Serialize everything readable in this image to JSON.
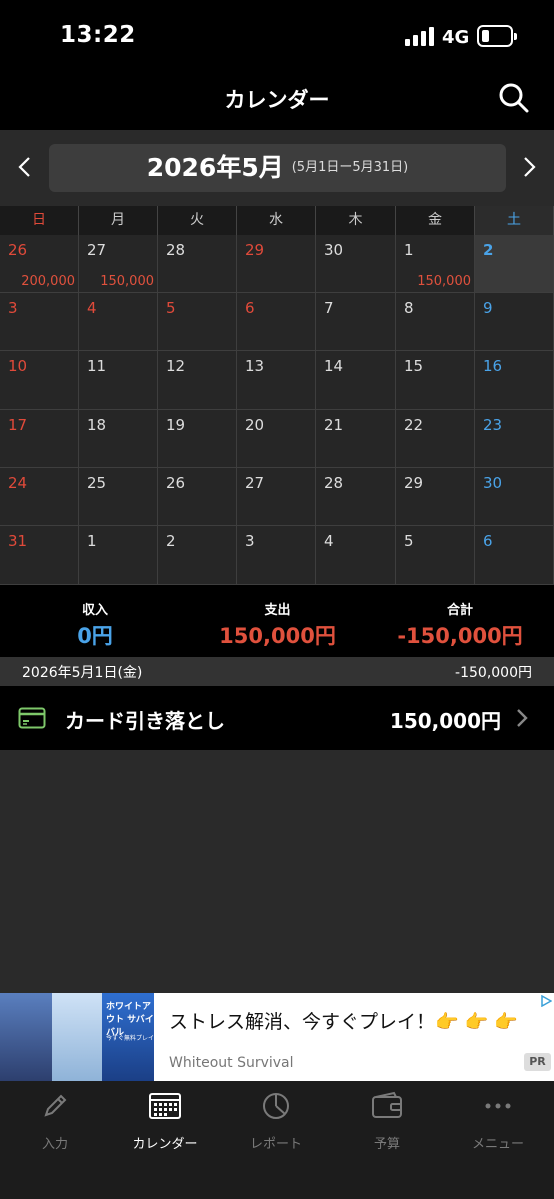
{
  "status_bar": {
    "time": "13:22",
    "network": "4G"
  },
  "header": {
    "title": "カレンダー"
  },
  "month_nav": {
    "month": "2026年5月",
    "range": "(5月1日ー5月31日)"
  },
  "weekdays": [
    "日",
    "月",
    "火",
    "水",
    "木",
    "金",
    "土"
  ],
  "calendar": {
    "weeks": [
      [
        {
          "day": "26",
          "amount": "200,000"
        },
        {
          "day": "27",
          "amount": "150,000"
        },
        {
          "day": "28",
          "amount": ""
        },
        {
          "day": "29",
          "amount": ""
        },
        {
          "day": "30",
          "amount": ""
        },
        {
          "day": "1",
          "amount": "150,000"
        },
        {
          "day": "2",
          "amount": ""
        }
      ],
      [
        {
          "day": "3",
          "amount": ""
        },
        {
          "day": "4",
          "amount": ""
        },
        {
          "day": "5",
          "amount": ""
        },
        {
          "day": "6",
          "amount": ""
        },
        {
          "day": "7",
          "amount": ""
        },
        {
          "day": "8",
          "amount": ""
        },
        {
          "day": "9",
          "amount": ""
        }
      ],
      [
        {
          "day": "10",
          "amount": ""
        },
        {
          "day": "11",
          "amount": ""
        },
        {
          "day": "12",
          "amount": ""
        },
        {
          "day": "13",
          "amount": ""
        },
        {
          "day": "14",
          "amount": ""
        },
        {
          "day": "15",
          "amount": ""
        },
        {
          "day": "16",
          "amount": ""
        }
      ],
      [
        {
          "day": "17",
          "amount": ""
        },
        {
          "day": "18",
          "amount": ""
        },
        {
          "day": "19",
          "amount": ""
        },
        {
          "day": "20",
          "amount": ""
        },
        {
          "day": "21",
          "amount": ""
        },
        {
          "day": "22",
          "amount": ""
        },
        {
          "day": "23",
          "amount": ""
        }
      ],
      [
        {
          "day": "24",
          "amount": ""
        },
        {
          "day": "25",
          "amount": ""
        },
        {
          "day": "26",
          "amount": ""
        },
        {
          "day": "27",
          "amount": ""
        },
        {
          "day": "28",
          "amount": ""
        },
        {
          "day": "29",
          "amount": ""
        },
        {
          "day": "30",
          "amount": ""
        }
      ],
      [
        {
          "day": "31",
          "amount": ""
        },
        {
          "day": "1",
          "amount": ""
        },
        {
          "day": "2",
          "amount": ""
        },
        {
          "day": "3",
          "amount": ""
        },
        {
          "day": "4",
          "amount": ""
        },
        {
          "day": "5",
          "amount": ""
        },
        {
          "day": "6",
          "amount": ""
        }
      ]
    ],
    "selected_day": "2"
  },
  "summary": {
    "income_label": "収入",
    "income_value": "0円",
    "expense_label": "支出",
    "expense_value": "150,000円",
    "total_label": "合計",
    "total_value": "-150,000円"
  },
  "date_bar": {
    "date": "2026年5月1日(金)",
    "total": "-150,000円"
  },
  "transaction": {
    "name": "カード引き落とし",
    "amount": "150,000円",
    "icon": "credit-card-icon"
  },
  "ad": {
    "headline": "ストレス解消、今すぐプレイ！👉 👉 👉",
    "brand": "Whiteout Survival",
    "pr_label": "PR",
    "thumb_logo": "ホワイトアウト サバイバル",
    "thumb_sub": "今すぐ無料プレイ"
  },
  "tabs": [
    {
      "label": "入力",
      "icon": "pencil-icon"
    },
    {
      "label": "カレンダー",
      "icon": "calendar-icon"
    },
    {
      "label": "レポート",
      "icon": "pie-chart-icon"
    },
    {
      "label": "予算",
      "icon": "wallet-icon"
    },
    {
      "label": "メニュー",
      "icon": "more-icon"
    }
  ],
  "colors": {
    "expense": "#e0513d",
    "income": "#4aa3e8",
    "sunday": "#e04a3a",
    "saturday": "#4aa3e8",
    "card_icon": "#7ec86a"
  }
}
